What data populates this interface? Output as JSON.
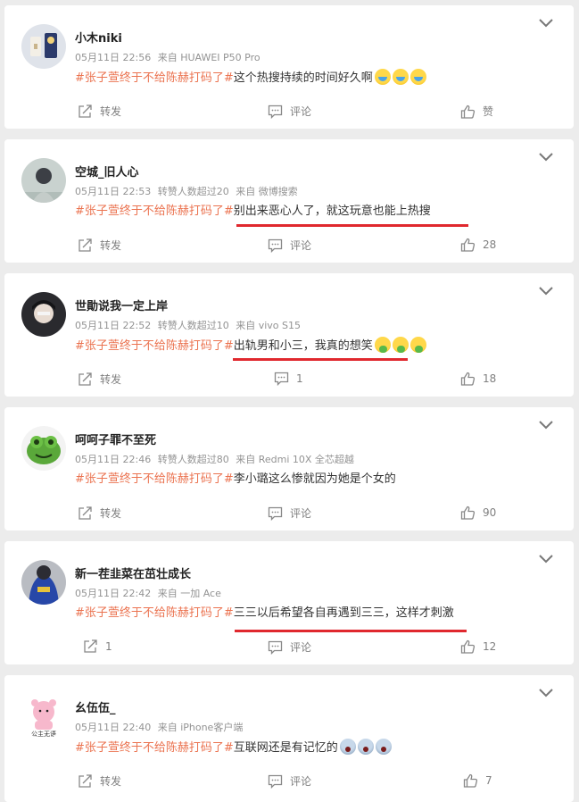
{
  "accent_color": "#eb7350",
  "highlight_color": "#e0282e",
  "icons": {
    "share": "share-icon",
    "comment": "comment-icon",
    "like": "thumbs-up-icon",
    "menu": "chevron-down-icon"
  },
  "posts": [
    {
      "username": "小木niki",
      "time": "05月11日 22:56",
      "reposts_note": "",
      "source": "来自 HUAWEI P50 Pro",
      "topic": "#张子萱终于不给陈赫打码了#",
      "text": "这个热搜持续的时间好久啊",
      "emoji": "laugh",
      "share": "转发",
      "comment": "评论",
      "like": "赞"
    },
    {
      "username": "空城_旧人心",
      "time": "05月11日 22:53",
      "reposts_note": "转赞人数超过20",
      "source": "来自 微博搜索",
      "topic": "#张子萱终于不给陈赫打码了#",
      "text": "别出来恶心人了，就这玩意也能上热搜",
      "emoji": "",
      "share": "转发",
      "comment": "评论",
      "like": "28"
    },
    {
      "username": "世勛说我一定上岸",
      "time": "05月11日 22:52",
      "reposts_note": "转赞人数超过10",
      "source": "来自 vivo S15",
      "topic": "#张子萱终于不给陈赫打码了#",
      "text": "出轨男和小三，我真的想笑",
      "emoji": "puke",
      "share": "转发",
      "comment": "1",
      "like": "18"
    },
    {
      "username": "呵呵子罪不至死",
      "time": "05月11日 22:46",
      "reposts_note": "转赞人数超过80",
      "source": "来自 Redmi 10X 全芯超越",
      "topic": "#张子萱终于不给陈赫打码了#",
      "text": "李小璐这么惨就因为她是个女的",
      "emoji": "",
      "share": "转发",
      "comment": "评论",
      "like": "90"
    },
    {
      "username": "新一茬韭菜在茁壮成长",
      "time": "05月11日 22:42",
      "reposts_note": "",
      "source": "来自 一加 Ace",
      "topic": "#张子萱终于不给陈赫打码了#",
      "text": "三三以后希望各自再遇到三三，这样才刺激",
      "emoji": "",
      "share": "1",
      "comment": "评论",
      "like": "12"
    },
    {
      "username": "幺伍伍_",
      "time": "05月11日 22:40",
      "reposts_note": "",
      "source": "来自 iPhone客户端",
      "topic": "#张子萱终于不给陈赫打码了#",
      "text": "互联网还是有记忆的",
      "emoji": "scared",
      "avatar_caption": "公主无语",
      "share": "转发",
      "comment": "评论",
      "like": "7"
    }
  ]
}
